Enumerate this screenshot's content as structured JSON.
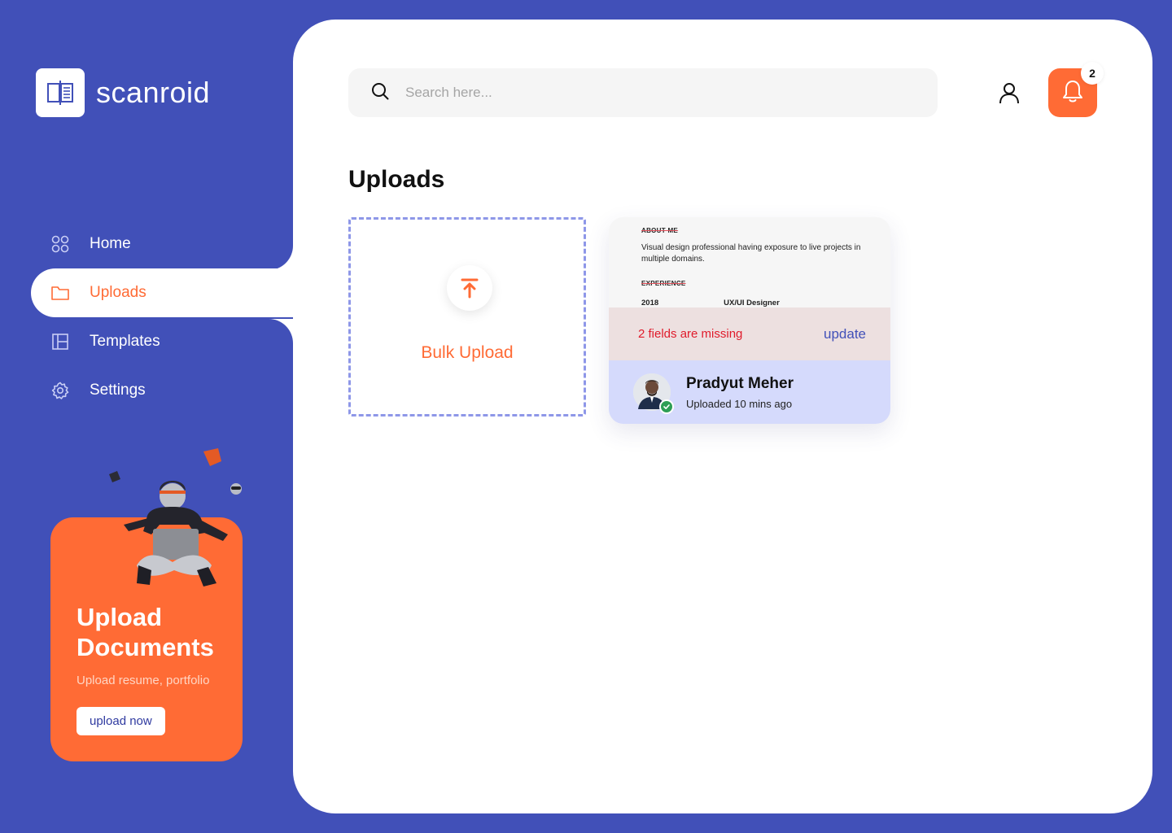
{
  "brand": {
    "name": "scanroid"
  },
  "sidebar": {
    "items": [
      {
        "label": "Home",
        "icon": "grid-icon",
        "active": false
      },
      {
        "label": "Uploads",
        "icon": "folder-icon",
        "active": true
      },
      {
        "label": "Templates",
        "icon": "layout-icon",
        "active": false
      },
      {
        "label": "Settings",
        "icon": "gear-icon",
        "active": false
      }
    ]
  },
  "promo": {
    "title_line1": "Upload",
    "title_line2": "Documents",
    "subtitle": "Upload resume, portfolio",
    "button_label": "upload now"
  },
  "header": {
    "search_placeholder": "Search here...",
    "notification_count": "2"
  },
  "main": {
    "title": "Uploads",
    "bulk_upload_label": "Bulk Upload",
    "document": {
      "about_heading": "ABOUT ME",
      "about_text": "Visual design professional having exposure to live projects in multiple domains.",
      "experience_heading": "EXPERIENCE",
      "experience_year": "2018",
      "experience_role": "UX/UI Designer",
      "warning": "2 fields are missing",
      "update_label": "update",
      "owner_name": "Pradyut Meher",
      "uploaded": "Uploaded 10 mins ago"
    }
  },
  "colors": {
    "brand_blue": "#4150B8",
    "accent_orange": "#FF6B35",
    "warning_red": "#E01B2B",
    "success_green": "#2E9E55"
  }
}
